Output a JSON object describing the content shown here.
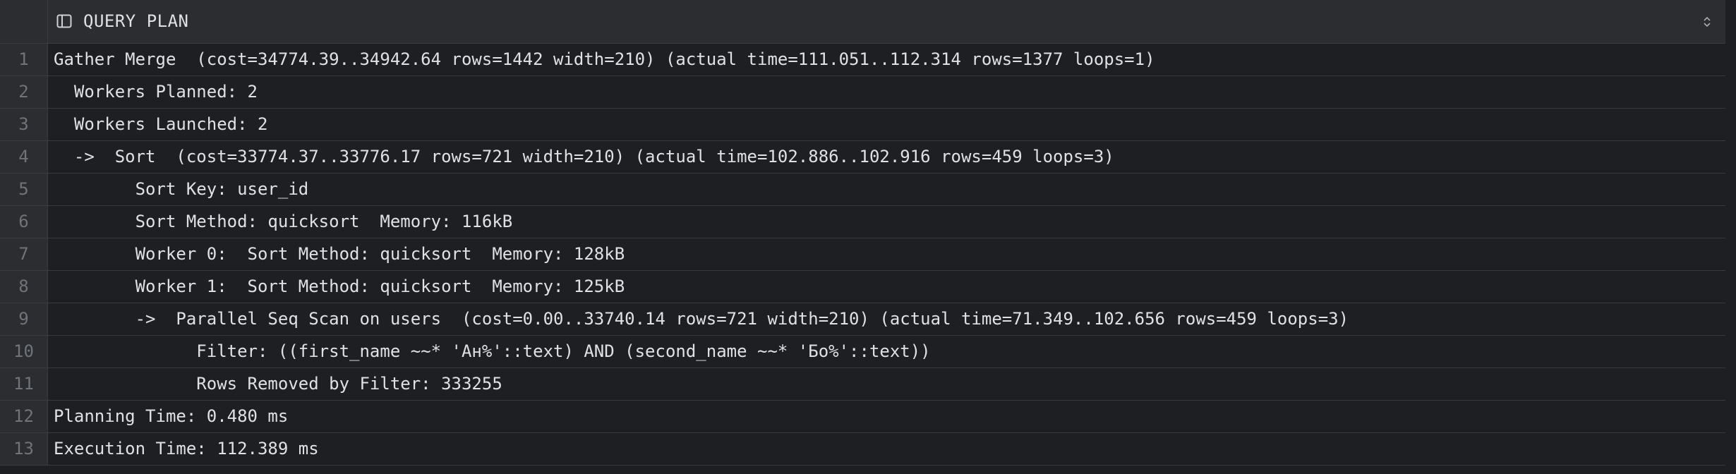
{
  "header": {
    "column_title": "QUERY PLAN",
    "column_icon": "column-table-icon",
    "sort_icon": "sort-updown-icon"
  },
  "rows": [
    {
      "num": "1",
      "text": "Gather Merge  (cost=34774.39..34942.64 rows=1442 width=210) (actual time=111.051..112.314 rows=1377 loops=1)"
    },
    {
      "num": "2",
      "text": "  Workers Planned: 2"
    },
    {
      "num": "3",
      "text": "  Workers Launched: 2"
    },
    {
      "num": "4",
      "text": "  ->  Sort  (cost=33774.37..33776.17 rows=721 width=210) (actual time=102.886..102.916 rows=459 loops=3)"
    },
    {
      "num": "5",
      "text": "        Sort Key: user_id"
    },
    {
      "num": "6",
      "text": "        Sort Method: quicksort  Memory: 116kB"
    },
    {
      "num": "7",
      "text": "        Worker 0:  Sort Method: quicksort  Memory: 128kB"
    },
    {
      "num": "8",
      "text": "        Worker 1:  Sort Method: quicksort  Memory: 125kB"
    },
    {
      "num": "9",
      "text": "        ->  Parallel Seq Scan on users  (cost=0.00..33740.14 rows=721 width=210) (actual time=71.349..102.656 rows=459 loops=3)"
    },
    {
      "num": "10",
      "text": "              Filter: ((first_name ~~* 'Ан%'::text) AND (second_name ~~* 'Бо%'::text))"
    },
    {
      "num": "11",
      "text": "              Rows Removed by Filter: 333255"
    },
    {
      "num": "12",
      "text": "Planning Time: 0.480 ms"
    },
    {
      "num": "13",
      "text": "Execution Time: 112.389 ms"
    }
  ]
}
